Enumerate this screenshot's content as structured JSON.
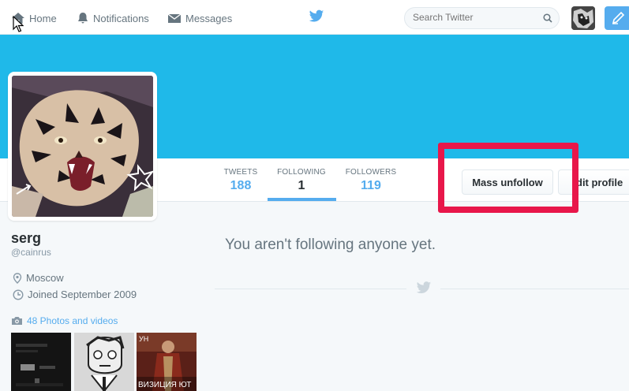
{
  "nav": {
    "home": "Home",
    "notifications": "Notifications",
    "messages": "Messages",
    "search_placeholder": "Search Twitter"
  },
  "profile": {
    "name": "serg",
    "handle": "@cainrus",
    "location": "Moscow",
    "joined": "Joined September 2009",
    "photos": "48 Photos and videos"
  },
  "stats": [
    {
      "label": "TWEETS",
      "value": "188"
    },
    {
      "label": "FOLLOWING",
      "value": "1"
    },
    {
      "label": "FOLLOWERS",
      "value": "119"
    }
  ],
  "buttons": {
    "mass_unfollow": "Mass unfollow",
    "edit_profile": "dit profile"
  },
  "main": {
    "empty_message": "You aren't following anyone yet."
  },
  "thumbs": {
    "third_caption_top": "УН",
    "third_caption_bottom": "ВИЗИЦИЯ ЮТ"
  },
  "colors": {
    "accent": "#55acee",
    "banner": "#1fb9e9",
    "highlight": "#e8174a"
  }
}
